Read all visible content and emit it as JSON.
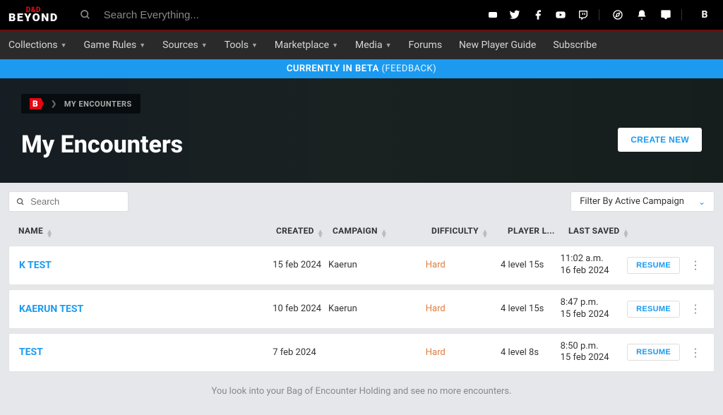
{
  "topbar": {
    "search_placeholder": "Search Everything...",
    "avatar_letter": "B"
  },
  "nav": {
    "items": [
      {
        "label": "Collections",
        "dropdown": true
      },
      {
        "label": "Game Rules",
        "dropdown": true
      },
      {
        "label": "Sources",
        "dropdown": true
      },
      {
        "label": "Tools",
        "dropdown": true
      },
      {
        "label": "Marketplace",
        "dropdown": true
      },
      {
        "label": "Media",
        "dropdown": true
      },
      {
        "label": "Forums",
        "dropdown": false
      },
      {
        "label": "New Player Guide",
        "dropdown": false
      },
      {
        "label": "Subscribe",
        "dropdown": false
      }
    ]
  },
  "beta": {
    "text": "CURRENTLY IN BETA",
    "feedback": "(FEEDBACK)"
  },
  "breadcrumb": {
    "current": "MY ENCOUNTERS"
  },
  "page": {
    "title": "My Encounters",
    "create_label": "CREATE NEW"
  },
  "filters": {
    "search_placeholder": "Search",
    "campaign_label": "Filter By Active Campaign"
  },
  "columns": {
    "name": "NAME",
    "created": "CREATED",
    "campaign": "CAMPAIGN",
    "difficulty": "DIFFICULTY",
    "players": "PLAYER L...",
    "saved": "LAST SAVED"
  },
  "actions": {
    "resume": "RESUME"
  },
  "rows": [
    {
      "name": "K TEST",
      "created": "15 feb 2024",
      "campaign": "Kaerun",
      "difficulty": "Hard",
      "players": "4 level 15s",
      "saved_time": "11:02 a.m.",
      "saved_date": "16 feb 2024"
    },
    {
      "name": "KAERUN TEST",
      "created": "10 feb 2024",
      "campaign": "Kaerun",
      "difficulty": "Hard",
      "players": "4 level 15s",
      "saved_time": "8:47 p.m.",
      "saved_date": "15 feb 2024"
    },
    {
      "name": "TEST",
      "created": "7 feb 2024",
      "campaign": "",
      "difficulty": "Hard",
      "players": "4 level 8s",
      "saved_time": "8:50 p.m.",
      "saved_date": "15 feb 2024"
    }
  ],
  "empty_text": "You look into your Bag of Encounter Holding and see no more encounters."
}
